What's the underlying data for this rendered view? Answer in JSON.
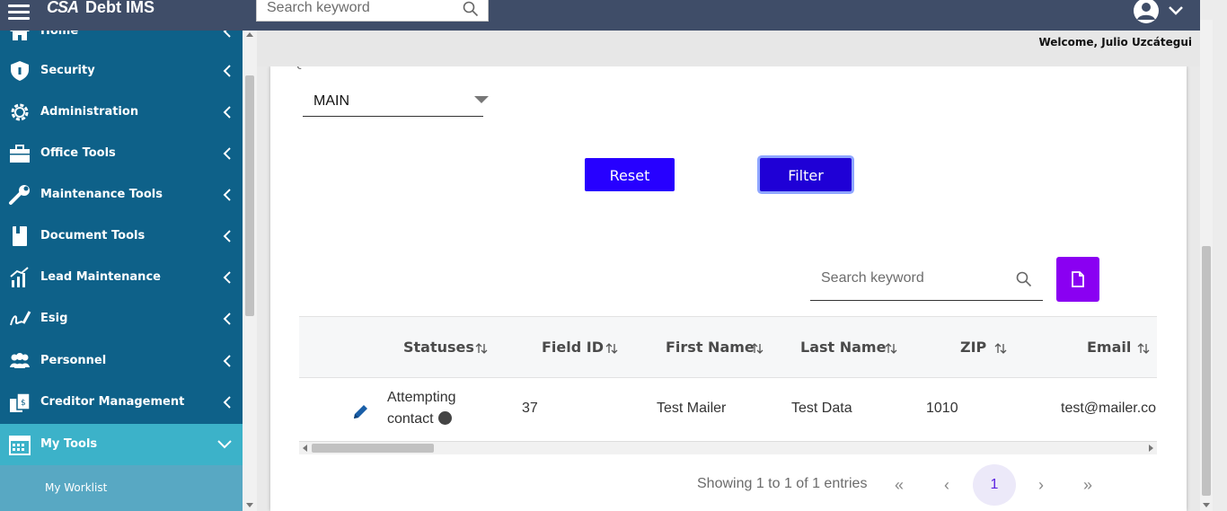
{
  "header": {
    "logo_text": "CSA",
    "app_title": "Debt IMS",
    "search_placeholder": "Search keyword",
    "welcome": "Welcome, Julio Uzcátegui"
  },
  "sidebar": {
    "items": [
      {
        "label": "Home",
        "icon": "home-icon"
      },
      {
        "label": "Security",
        "icon": "shield-icon"
      },
      {
        "label": "Administration",
        "icon": "gear-icon"
      },
      {
        "label": "Office Tools",
        "icon": "briefcase-icon"
      },
      {
        "label": "Maintenance Tools",
        "icon": "wrench-icon"
      },
      {
        "label": "Document Tools",
        "icon": "book-icon"
      },
      {
        "label": "Lead Maintenance",
        "icon": "bar-chart-icon"
      },
      {
        "label": "Esig",
        "icon": "signature-icon"
      },
      {
        "label": "Personnel",
        "icon": "users-icon"
      },
      {
        "label": "Creditor Management",
        "icon": "invoice-icon"
      },
      {
        "label": "My Tools",
        "icon": "calendar-icon"
      }
    ],
    "sub_items": [
      {
        "label": "My Worklist"
      }
    ]
  },
  "filters": {
    "queue_label": "Queue",
    "queue_value": "MAIN",
    "reset_label": "Reset",
    "filter_label": "Filter"
  },
  "table": {
    "search_placeholder": "Search keyword",
    "columns": [
      "Statuses",
      "Field ID",
      "First Name",
      "Last Name",
      "ZIP",
      "Email"
    ],
    "rows": [
      {
        "status_line1": "Attempting",
        "status_line2": "contact",
        "field_id": "37",
        "first_name": "Test Mailer",
        "last_name": "Test Data",
        "zip": "1010",
        "email": "test@mailer.co"
      }
    ]
  },
  "pagination": {
    "showing": "Showing 1 to 1 of 1 entries",
    "current_page": "1",
    "first": "«",
    "prev": "‹",
    "next": "›",
    "last": "»"
  },
  "colors": {
    "topbar": "#3f4d68",
    "sidebar": "#0e6189",
    "sidebar_active": "#3cb2c9",
    "primary_button": "#2700ff",
    "export_button": "#8a00f2"
  }
}
